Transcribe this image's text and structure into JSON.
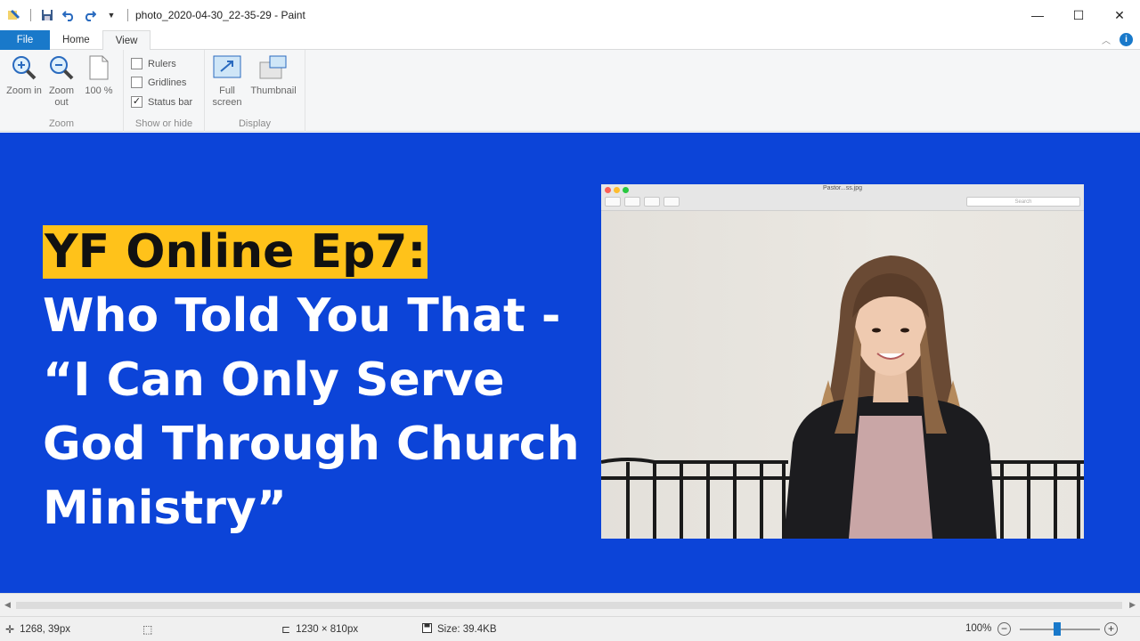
{
  "window": {
    "title": "photo_2020-04-30_22-35-29 - Paint",
    "controls": {
      "minimize": "—",
      "maximize": "☐",
      "close": "✕"
    }
  },
  "quick_access": {
    "icons": [
      "paint-app-icon",
      "save-icon",
      "undo-icon",
      "redo-icon",
      "customize-dropdown-icon"
    ]
  },
  "ribbon": {
    "tabs": [
      {
        "label": "File",
        "active": false
      },
      {
        "label": "Home",
        "active": false
      },
      {
        "label": "View",
        "active": true
      }
    ],
    "zoom_group": {
      "label": "Zoom",
      "zoom_in": "Zoom in",
      "zoom_out": "Zoom out",
      "hundred": "100 %"
    },
    "show_hide_group": {
      "label": "Show or hide",
      "rulers": {
        "label": "Rulers",
        "checked": false
      },
      "gridlines": {
        "label": "Gridlines",
        "checked": false
      },
      "status_bar": {
        "label": "Status bar",
        "checked": true
      }
    },
    "display_group": {
      "label": "Display",
      "full_screen": "Full screen",
      "thumbnail": "Thumbnail"
    }
  },
  "canvas": {
    "background_color": "#0c44d8",
    "headline": {
      "highlight": "YF Online Ep7:",
      "lines": [
        "Who Told You That -",
        "“I Can Only Serve",
        "God Through Church",
        "Ministry”"
      ]
    },
    "photo": {
      "window_title": "Pastor...ss.jpg",
      "search_placeholder": "Search"
    }
  },
  "status_bar": {
    "cursor_position": "1268, 39px",
    "image_size": "1230 × 810px",
    "file_size": "Size: 39.4KB",
    "zoom": "100%"
  },
  "colors": {
    "accent": "#1979ca",
    "highlight_yellow": "#ffc21a"
  }
}
